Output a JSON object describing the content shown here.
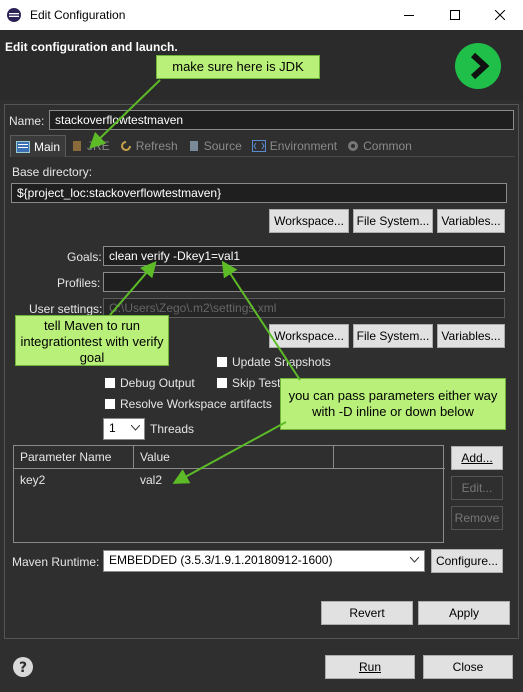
{
  "window": {
    "title": "Edit Configuration"
  },
  "header": {
    "heading": "Edit configuration and launch."
  },
  "name": {
    "label": "Name:",
    "value": "stackoverflowtestmaven"
  },
  "tabs": [
    {
      "label": "Main"
    },
    {
      "label": "JRE"
    },
    {
      "label": "Refresh"
    },
    {
      "label": "Source"
    },
    {
      "label": "Environment"
    },
    {
      "label": "Common"
    }
  ],
  "base_dir": {
    "label": "Base directory:",
    "value": "${project_loc:stackoverflowtestmaven}",
    "workspace_label": "Workspace...",
    "filesystem_label": "File System...",
    "variables_label": "Variables..."
  },
  "goals": {
    "label": "Goals:",
    "value": "clean verify -Dkey1=val1"
  },
  "profiles": {
    "label": "Profiles:",
    "value": ""
  },
  "user_settings": {
    "label": "User settings:",
    "value": "C:\\Users\\Zego\\.m2\\settings.xml",
    "workspace_label": "Workspace...",
    "filesystem_label": "File System...",
    "variables_label": "Variables..."
  },
  "options": {
    "update_snapshots": "Update Snapshots",
    "debug_output": "Debug Output",
    "skip_tests": "Skip Tests",
    "resolve_workspace": "Resolve Workspace artifacts",
    "threads_value": "1",
    "threads_label": "Threads"
  },
  "params": {
    "headers": [
      "Parameter Name",
      "Value"
    ],
    "rows": [
      {
        "name": "key2",
        "value": "val2"
      }
    ],
    "add_label": "Add...",
    "edit_label": "Edit...",
    "remove_label": "Remove"
  },
  "runtime": {
    "label": "Maven Runtime:",
    "value": "EMBEDDED (3.5.3/1.9.1.20180912-1600)",
    "configure_label": "Configure..."
  },
  "actions": {
    "revert_label": "Revert",
    "apply_label": "Apply",
    "run_label": "Run",
    "close_label": "Close"
  },
  "annotations": {
    "jdk_note": "make sure here is JDK",
    "maven_note": "tell Maven to run integrationtest with verify goal",
    "params_note": "you can pass parameters either way with -D inline or down below"
  },
  "colors": {
    "callout": "#b9f07a",
    "arrow": "#5dbb28",
    "launch": "#1fbf4a"
  },
  "icons": [
    "eclipse-icon",
    "minimize-icon",
    "maximize-icon",
    "close-icon",
    "launch-icon",
    "main-tab-icon",
    "jre-icon",
    "refresh-icon",
    "source-icon",
    "environment-icon",
    "common-icon",
    "chevron-down-icon",
    "help-icon"
  ]
}
